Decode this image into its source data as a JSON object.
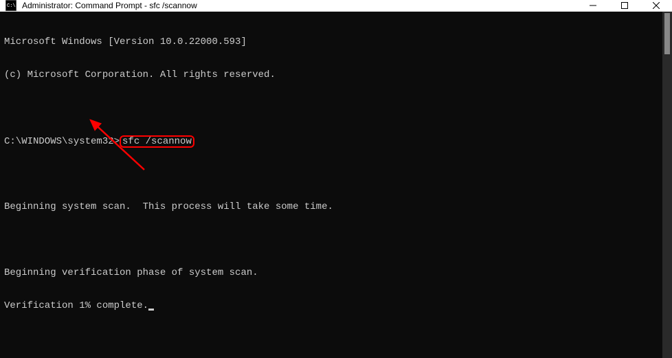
{
  "window": {
    "title": "Administrator: Command Prompt - sfc  /scannow"
  },
  "terminal": {
    "lines": {
      "version": "Microsoft Windows [Version 10.0.22000.593]",
      "copyright": "(c) Microsoft Corporation. All rights reserved.",
      "prompt": "C:\\WINDOWS\\system32>",
      "command": "sfc /scannow",
      "scan_begin": "Beginning system scan.  This process will take some time.",
      "verify_begin": "Beginning verification phase of system scan.",
      "verify_progress": "Verification 1% complete."
    }
  },
  "annotation": {
    "highlight_color": "#ff0000"
  }
}
